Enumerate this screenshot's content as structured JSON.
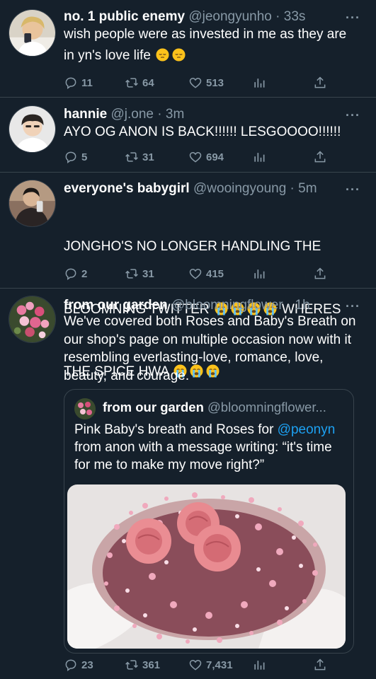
{
  "tweets": [
    {
      "name": "no. 1 public enemy",
      "handle": "@jeongyunho",
      "time": "33s",
      "text": "wish people were as invested in me as they are in yn's love life",
      "emoji": [
        "😔",
        "😔"
      ],
      "replies": "11",
      "retweets": "64",
      "likes": "513"
    },
    {
      "name": "hannie",
      "handle": "@j.one",
      "time": "3m",
      "text": "AYO OG ANON IS BACK!!!!!! LESGOOOO!!!!!!",
      "replies": "5",
      "retweets": "31",
      "likes": "694"
    },
    {
      "name": "everyone's babygirl",
      "handle": "@wooingyoung",
      "time": "5m",
      "text_line1": "JONGHO'S NO LONGER HANDLING THE",
      "text_line2": "BLOOMNING TWITTER",
      "text_line2b": "WHERES",
      "text_line3": "THE SPICE HWA",
      "emoji": [
        "😭",
        "😭",
        "😭",
        "😭",
        "😭",
        "😭",
        "😭"
      ],
      "replies": "2",
      "retweets": "31",
      "likes": "415"
    },
    {
      "name": "from our garden",
      "handle": "@bloomningflower",
      "time": "1h",
      "text": "We've covered both Roses and Baby's Breath on our shop's page on multiple occasion now with it resembling everlasting-love, romance, love, beauty, and courage.",
      "quote": {
        "name": "from our garden",
        "handle": "@bloomningflower...",
        "text_before": "Pink Baby's breath and Roses for ",
        "mention": "@peonyn",
        "text_after": " from anon with a message writing: “it's time for me to make my move right?”"
      },
      "replies": "23",
      "retweets": "361",
      "likes": "7,431"
    }
  ],
  "colors": {
    "background": "#15202b",
    "secondary_text": "#8899a6",
    "divider": "#38444d",
    "link": "#1da1f2"
  },
  "icons": [
    "reply-icon",
    "retweet-icon",
    "like-icon",
    "analytics-icon",
    "share-icon",
    "more-icon"
  ]
}
